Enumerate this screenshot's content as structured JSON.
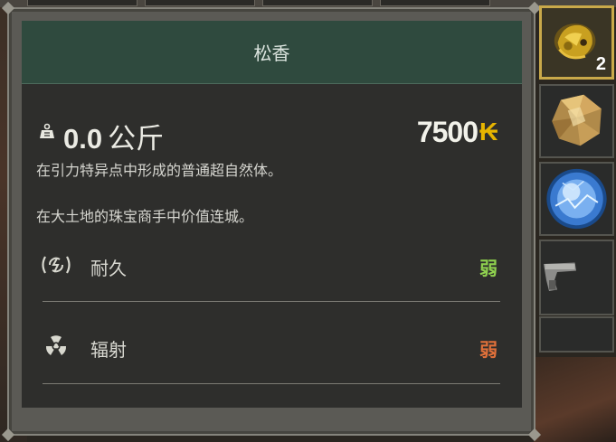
{
  "item": {
    "name": "松香",
    "weight_value": "0.0",
    "weight_unit": "公斤",
    "price": "7500",
    "currency_symbol": "₭",
    "description_1": "在引力特异点中形成的普通超自然体。",
    "description_2": "在大土地的珠宝商手中价值连城。"
  },
  "stats": [
    {
      "icon": "durability-icon",
      "label": "耐久",
      "value": "弱",
      "color": "#8fd14f"
    },
    {
      "icon": "radiation-icon",
      "label": "辐射",
      "value": "弱",
      "color": "#e0703a"
    }
  ],
  "inventory": [
    {
      "icon": "rosin-artifact-icon",
      "count": "2",
      "selected": true
    },
    {
      "icon": "amber-crystal-icon",
      "selected": false
    },
    {
      "icon": "blue-orb-artifact-icon",
      "selected": false
    },
    {
      "icon": "pistol-icon",
      "selected": false
    },
    {
      "icon": "empty-slot",
      "selected": false
    }
  ],
  "colors": {
    "header": "#2f4a3e",
    "accent_price": "#e6b400"
  }
}
